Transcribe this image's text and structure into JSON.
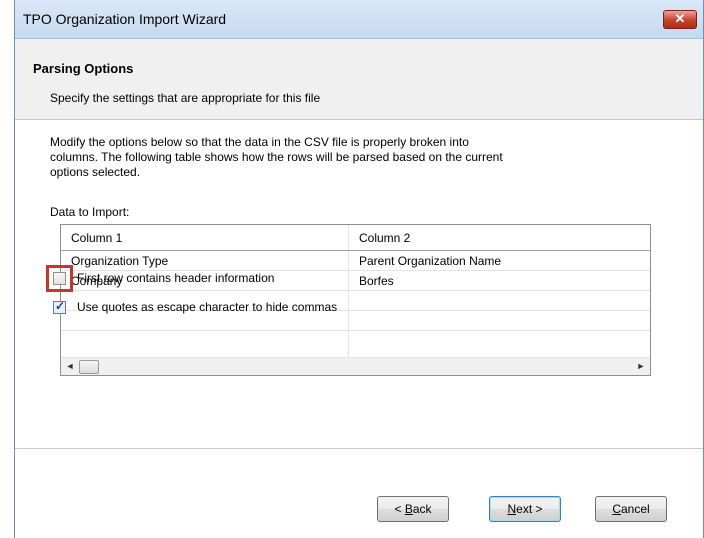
{
  "window": {
    "title": "TPO Organization Import Wizard",
    "close_glyph": "✕"
  },
  "header": {
    "title": "Parsing Options",
    "subtitle": "Specify the settings that are appropriate for this file"
  },
  "body": {
    "description_line1": "Modify the options below so that the data in the CSV file is properly broken into",
    "description_line2": "columns. The following table shows how the rows will be parsed based on the current",
    "description_line3": "options selected.",
    "data_label": "Data to Import:"
  },
  "grid": {
    "columns": [
      "Column 1",
      "Column 2"
    ],
    "rows": [
      [
        "Organization Type",
        "Parent Organization Name"
      ],
      [
        "Company",
        "Borfes"
      ],
      [
        "",
        ""
      ],
      [
        "",
        ""
      ]
    ],
    "scroll_left_glyph": "◄",
    "scroll_right_glyph": "►"
  },
  "options": {
    "first_row_header": {
      "label": "First row contains header information",
      "checked": false
    },
    "use_quotes": {
      "label": "Use quotes as escape character to hide commas",
      "checked": true,
      "check_glyph": "✓"
    }
  },
  "buttons": {
    "back_prefix": "< ",
    "back_mnemonic": "B",
    "back_rest": "ack",
    "next_mnemonic": "N",
    "next_rest": "ext >",
    "cancel_mnemonic": "C",
    "cancel_rest": "ancel"
  },
  "colors": {
    "highlight": "#c0392b",
    "titlebar": "#c5d9ef",
    "close_button": "#c4412a"
  }
}
